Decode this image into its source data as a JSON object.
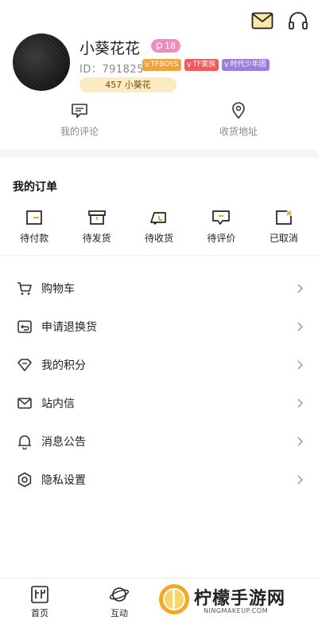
{
  "header": {
    "mail_icon": "mail-icon",
    "support_icon": "headphones-icon"
  },
  "profile": {
    "username": "小葵花花",
    "level": "18",
    "id_text": "ID：791825",
    "tags": [
      {
        "label": "TFBOYS",
        "color": "#f2a43a"
      },
      {
        "label": "TF家族",
        "color": "#ec5c5c"
      },
      {
        "label": "时代少年团",
        "color": "#9b7ee0"
      }
    ],
    "points_label": "457 小葵花"
  },
  "quick_actions": [
    {
      "label": "我的评论",
      "icon": "comment-icon"
    },
    {
      "label": "收货地址",
      "icon": "location-pin-icon"
    }
  ],
  "orders": {
    "title": "我的订单",
    "items": [
      {
        "label": "待付款",
        "icon": "wallet-icon"
      },
      {
        "label": "待发货",
        "icon": "box-icon"
      },
      {
        "label": "待收货",
        "icon": "truck-icon"
      },
      {
        "label": "待评价",
        "icon": "review-icon"
      },
      {
        "label": "已取消",
        "icon": "cancelled-icon"
      }
    ]
  },
  "menu": [
    {
      "label": "购物车",
      "icon": "cart-icon"
    },
    {
      "label": "申请退换货",
      "icon": "return-icon"
    },
    {
      "label": "我的积分",
      "icon": "diamond-icon"
    },
    {
      "label": "站内信",
      "icon": "envelope-icon"
    },
    {
      "label": "消息公告",
      "icon": "bell-icon"
    },
    {
      "label": "隐私设置",
      "icon": "gear-icon"
    }
  ],
  "bottom_nav": [
    {
      "label": "首页",
      "icon": "home-icon"
    },
    {
      "label": "互动",
      "icon": "planet-icon"
    }
  ],
  "watermark": {
    "title": "柠檬手游网",
    "subtitle": "NINGMAKEUP.COM"
  },
  "colors": {
    "level_badge": "#f08bbd",
    "points_bg": "#fcebc2",
    "accent_orange": "#f2a43a"
  }
}
